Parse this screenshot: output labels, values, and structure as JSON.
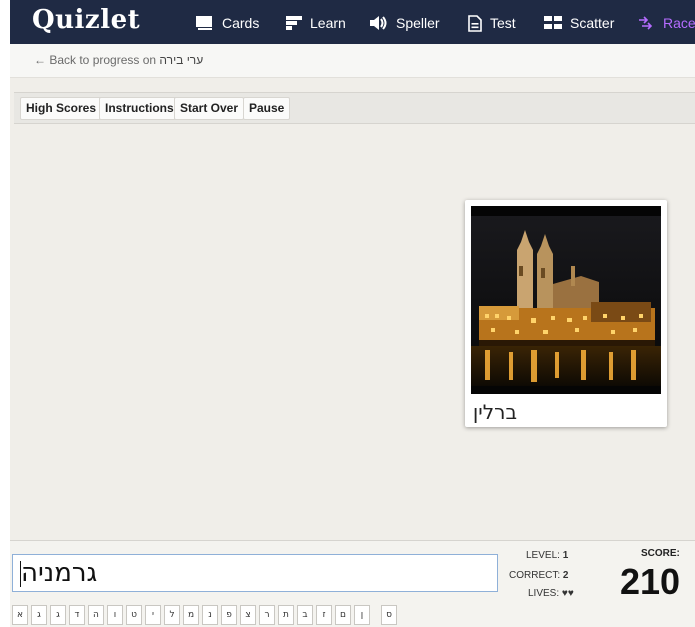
{
  "app": {
    "logo": "Quizlet"
  },
  "nav": {
    "items": [
      {
        "label": "Cards",
        "icon": "cards-icon"
      },
      {
        "label": "Learn",
        "icon": "learn-icon"
      },
      {
        "label": "Speller",
        "icon": "speaker-icon"
      },
      {
        "label": "Test",
        "icon": "test-icon"
      },
      {
        "label": "Scatter",
        "icon": "scatter-icon"
      },
      {
        "label": "Race",
        "icon": "race-icon"
      }
    ],
    "race_color": "#b56cff"
  },
  "back": {
    "prefix": "← Back to progress on",
    "set_name": "ערי בירה"
  },
  "toolbar": {
    "high_scores": "High Scores",
    "instructions": "Instructions",
    "start_over": "Start Over",
    "pause": "Pause"
  },
  "card": {
    "label": "ברלין"
  },
  "answer": {
    "value": "גרמניה"
  },
  "stats": {
    "level_label": "LEVEL:",
    "level": "1",
    "correct_label": "CORRECT:",
    "correct": "2",
    "lives_label": "LIVES:",
    "lives": "♥♥",
    "score_label": "SCORE:",
    "score": "210"
  },
  "keyboard": [
    "א",
    "ג",
    "ג",
    "ד",
    "ה",
    "ו",
    "ט",
    "י",
    "ל",
    "מ",
    "נ",
    "פ",
    "צ",
    "ר",
    "ת",
    "ב",
    "ז",
    "ם",
    "ן",
    "ס"
  ]
}
